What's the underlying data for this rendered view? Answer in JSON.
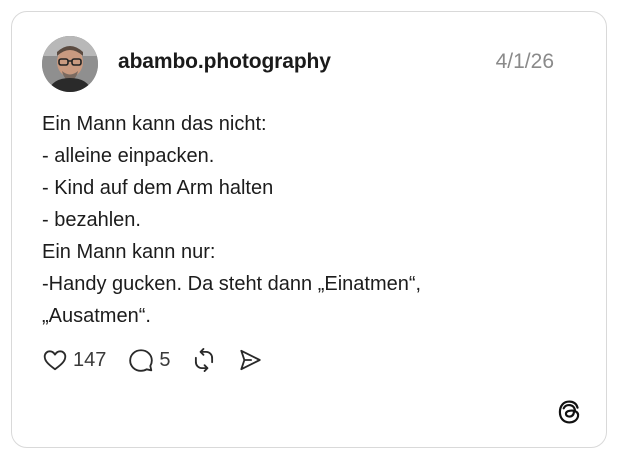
{
  "post": {
    "username": "abambo.photography",
    "date": "4/1/26",
    "lines": [
      "Ein Mann kann das nicht:",
      "- alleine einpacken.",
      "- Kind auf dem Arm halten",
      "- bezahlen.",
      "Ein Mann kann nur:",
      "-Handy gucken. Da steht dann „Einatmen“,",
      "„Ausatmen“."
    ]
  },
  "actions": {
    "like_icon": "heart-icon",
    "like_count": "147",
    "reply_icon": "speech-bubble-icon",
    "reply_count": "5",
    "repost_icon": "repost-icon",
    "share_icon": "send-icon"
  },
  "branding": {
    "logo": "threads-logo-icon"
  },
  "colors": {
    "text": "#1c1c1c",
    "muted": "#8a8a8a",
    "border": "#d9d9d9"
  }
}
